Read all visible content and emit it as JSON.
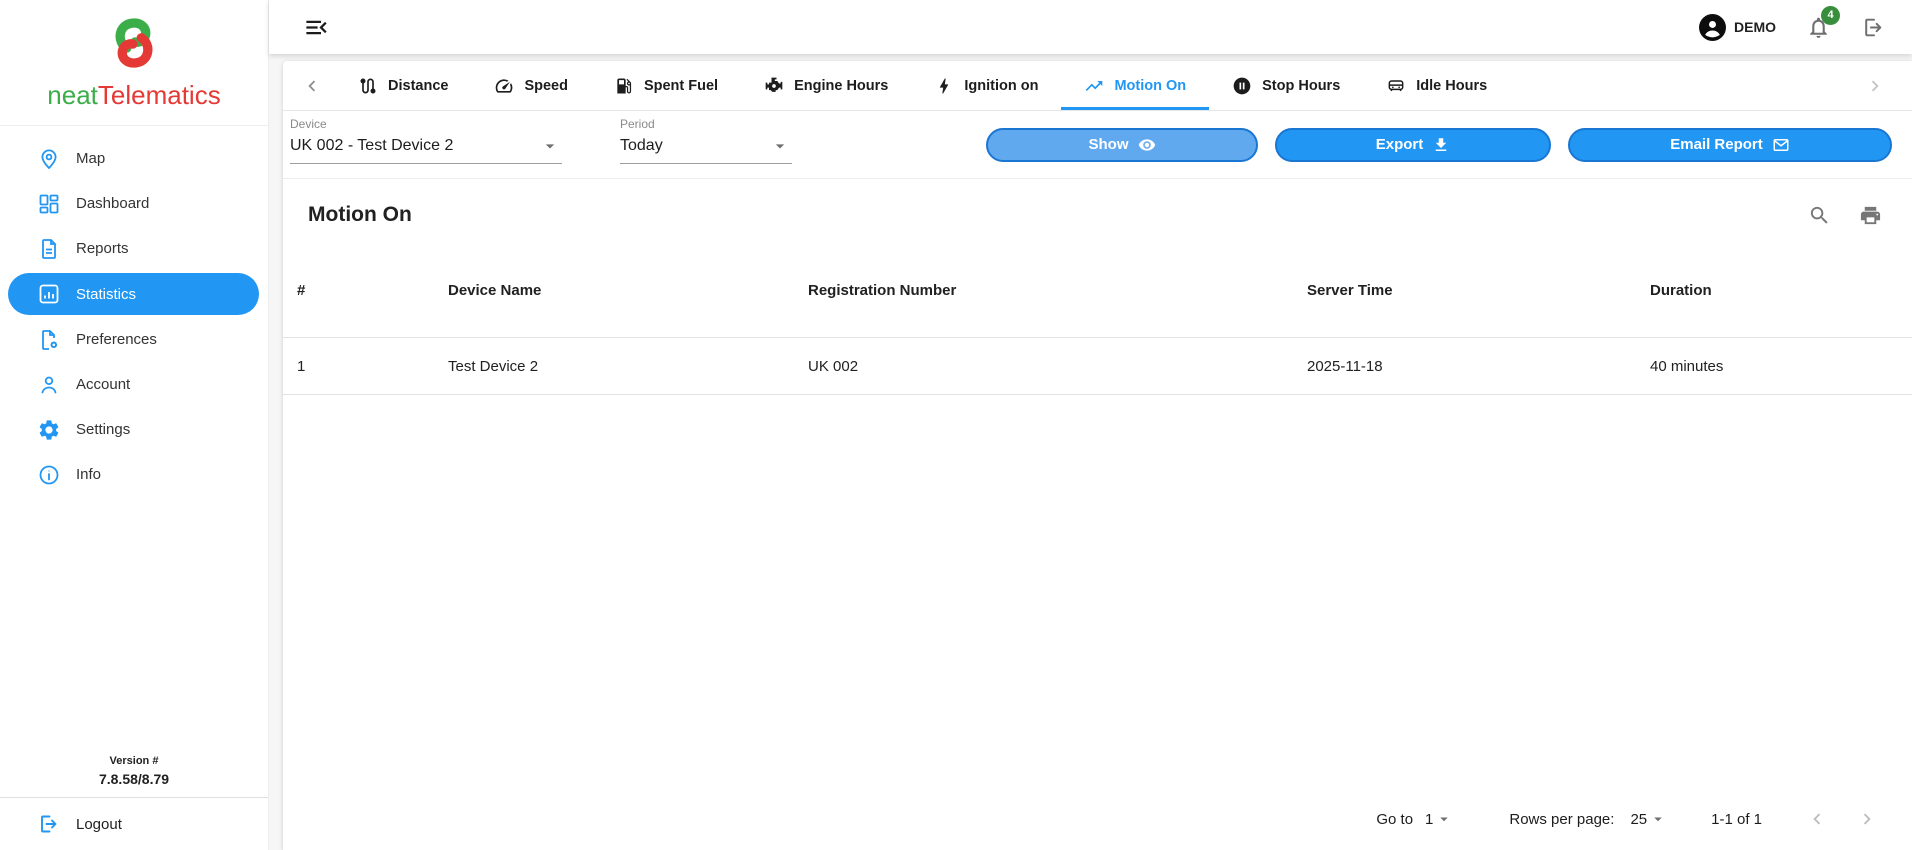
{
  "brand": {
    "name_part1": "neat",
    "name_part2": "Telematics"
  },
  "topbar": {
    "user": "DEMO",
    "notifications_count": "4"
  },
  "sidebar": {
    "items": [
      {
        "label": "Map"
      },
      {
        "label": "Dashboard"
      },
      {
        "label": "Reports"
      },
      {
        "label": "Statistics",
        "active": true
      },
      {
        "label": "Preferences"
      },
      {
        "label": "Account"
      },
      {
        "label": "Settings"
      },
      {
        "label": "Info"
      }
    ],
    "version_label": "Version #",
    "version_value": "7.8.58/8.79",
    "logout_label": "Logout"
  },
  "tabs": [
    {
      "label": "Distance"
    },
    {
      "label": "Speed"
    },
    {
      "label": "Spent Fuel"
    },
    {
      "label": "Engine Hours"
    },
    {
      "label": "Ignition on"
    },
    {
      "label": "Motion On",
      "active": true
    },
    {
      "label": "Stop Hours"
    },
    {
      "label": "Idle Hours"
    }
  ],
  "filters": {
    "device_label": "Device",
    "device_value": "UK 002 - Test Device 2",
    "period_label": "Period",
    "period_value": "Today",
    "show_label": "Show",
    "export_label": "Export",
    "email_label": "Email Report"
  },
  "report": {
    "title": "Motion On",
    "columns": [
      "#",
      "Device Name",
      "Registration Number",
      "Server Time",
      "Duration"
    ],
    "rows": [
      [
        "1",
        "Test Device 2",
        "UK 002",
        "2025-11-18",
        "40 minutes"
      ]
    ]
  },
  "pagination": {
    "goto_label": "Go to",
    "goto_value": "1",
    "rows_per_page_label": "Rows per page:",
    "rows_per_page_value": "25",
    "range": "1-1 of 1"
  },
  "icons": [
    "logo-swirl",
    "menu-open",
    "avatar",
    "bell",
    "logout",
    "map-pin",
    "dashboard-grid",
    "document",
    "bar-chart",
    "preferences-doc-gear",
    "person",
    "gear",
    "info",
    "route",
    "speedometer",
    "fuel-pump",
    "engine",
    "bolt",
    "trending-up",
    "pause-circle",
    "car",
    "eye",
    "download",
    "envelope",
    "search",
    "printer",
    "dropdown-caret",
    "chevron-left",
    "chevron-right"
  ],
  "colors": {
    "accent": "#2196F3",
    "accent-dark": "#1976D2",
    "show-fill": "#61A9EF",
    "badge-green": "#388E3C",
    "logo-green": "#3CAE49",
    "logo-red": "#E53935"
  }
}
